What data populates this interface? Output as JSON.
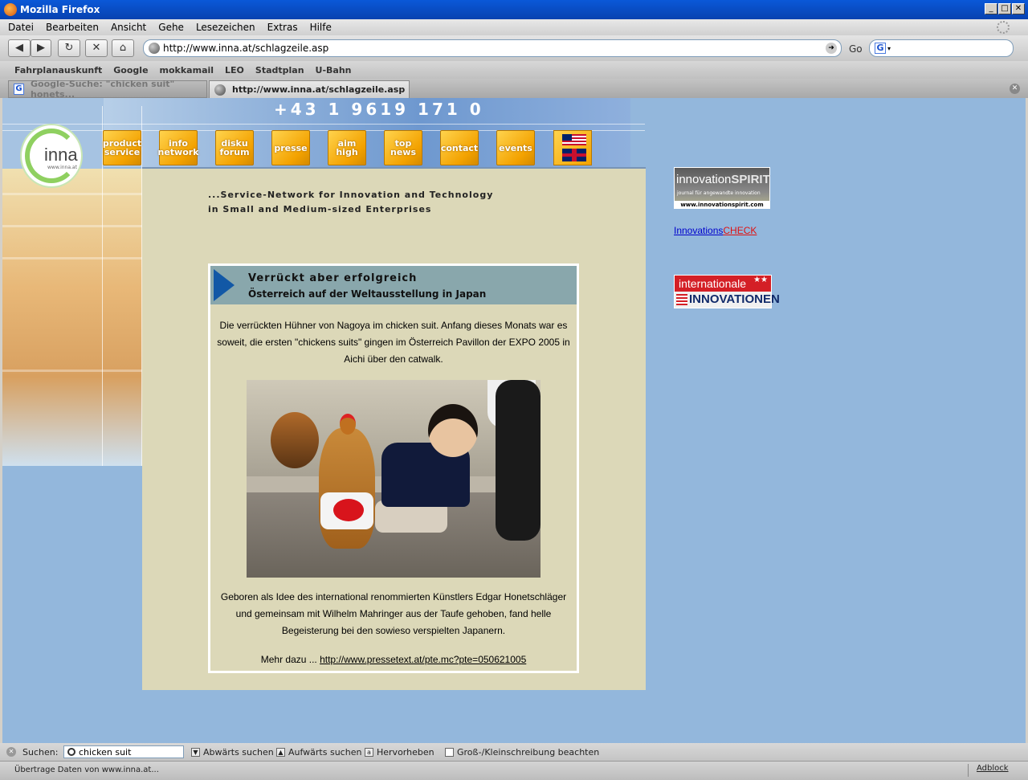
{
  "window": {
    "title": "Mozilla Firefox"
  },
  "menu": [
    "Datei",
    "Bearbeiten",
    "Ansicht",
    "Gehe",
    "Lesezeichen",
    "Extras",
    "Hilfe"
  ],
  "nav": {
    "url": "http://www.inna.at/schlagzeile.asp",
    "go_label": "Go",
    "search_engine_icon": "G"
  },
  "bookmarks": [
    "Fahrplanauskunft",
    "Google",
    "mokkamail",
    "LEO",
    "Stadtplan",
    "U-Bahn"
  ],
  "tabs": [
    {
      "label": "Google-Suche: \"chicken suit\" honets...",
      "active": false
    },
    {
      "label": "http://www.inna.at/schlagzeile.asp",
      "active": true
    }
  ],
  "page": {
    "phone": "+43 1 9619 171 0",
    "logo_text": "inna",
    "logo_url": "www.inna.at",
    "nav_buttons": [
      [
        "product",
        "service"
      ],
      [
        "info",
        "network"
      ],
      [
        "disku",
        "forum"
      ],
      [
        "presse"
      ],
      [
        "aim",
        "high"
      ],
      [
        "top",
        "news"
      ],
      [
        "contact"
      ],
      [
        "events"
      ]
    ],
    "tagline_1": "...Service-Network for Innovation and Technology",
    "tagline_2": "in Small and Medium-sized Enterprises",
    "article": {
      "title": "Verrückt aber erfolgreich",
      "subtitle": "Österreich auf der Weltausstellung in Japan",
      "para1": "Die verrückten Hühner von Nagoya im chicken suit. Anfang dieses Monats war es soweit, die ersten \"chickens suits\" gingen im Österreich Pavillon der EXPO 2005 in Aichi über den catwalk.",
      "para2": "Geboren als Idee des international renommierten Künstlers Edgar Honetschläger und gemeinsam mit Wilhelm Mahringer aus der Taufe gehoben, fand helle Begeisterung bei den sowieso verspielten Japanern.",
      "more_prefix": "Mehr dazu ...",
      "more_link": "http://www.pressetext.at/pte.mc?pte=050621005"
    },
    "right": {
      "spirit_1": "innovation",
      "spirit_2": "SPIRIT",
      "spirit_sub": "journal für angewandte innovation",
      "spirit_url": "www.innovationspirit.com",
      "check_a": "Innovations",
      "check_b": "CHECK",
      "intl_1": "internationale",
      "intl_2": "INNOVATIONEN"
    }
  },
  "findbar": {
    "label": "Suchen:",
    "value": "chicken suit",
    "down": "Abwärts suchen",
    "up": "Aufwärts suchen",
    "highlight": "Hervorheben",
    "case": "Groß-/Kleinschreibung beachten"
  },
  "status": {
    "text": "Übertrage Daten von www.inna.at...",
    "adblock": "Adblock"
  }
}
